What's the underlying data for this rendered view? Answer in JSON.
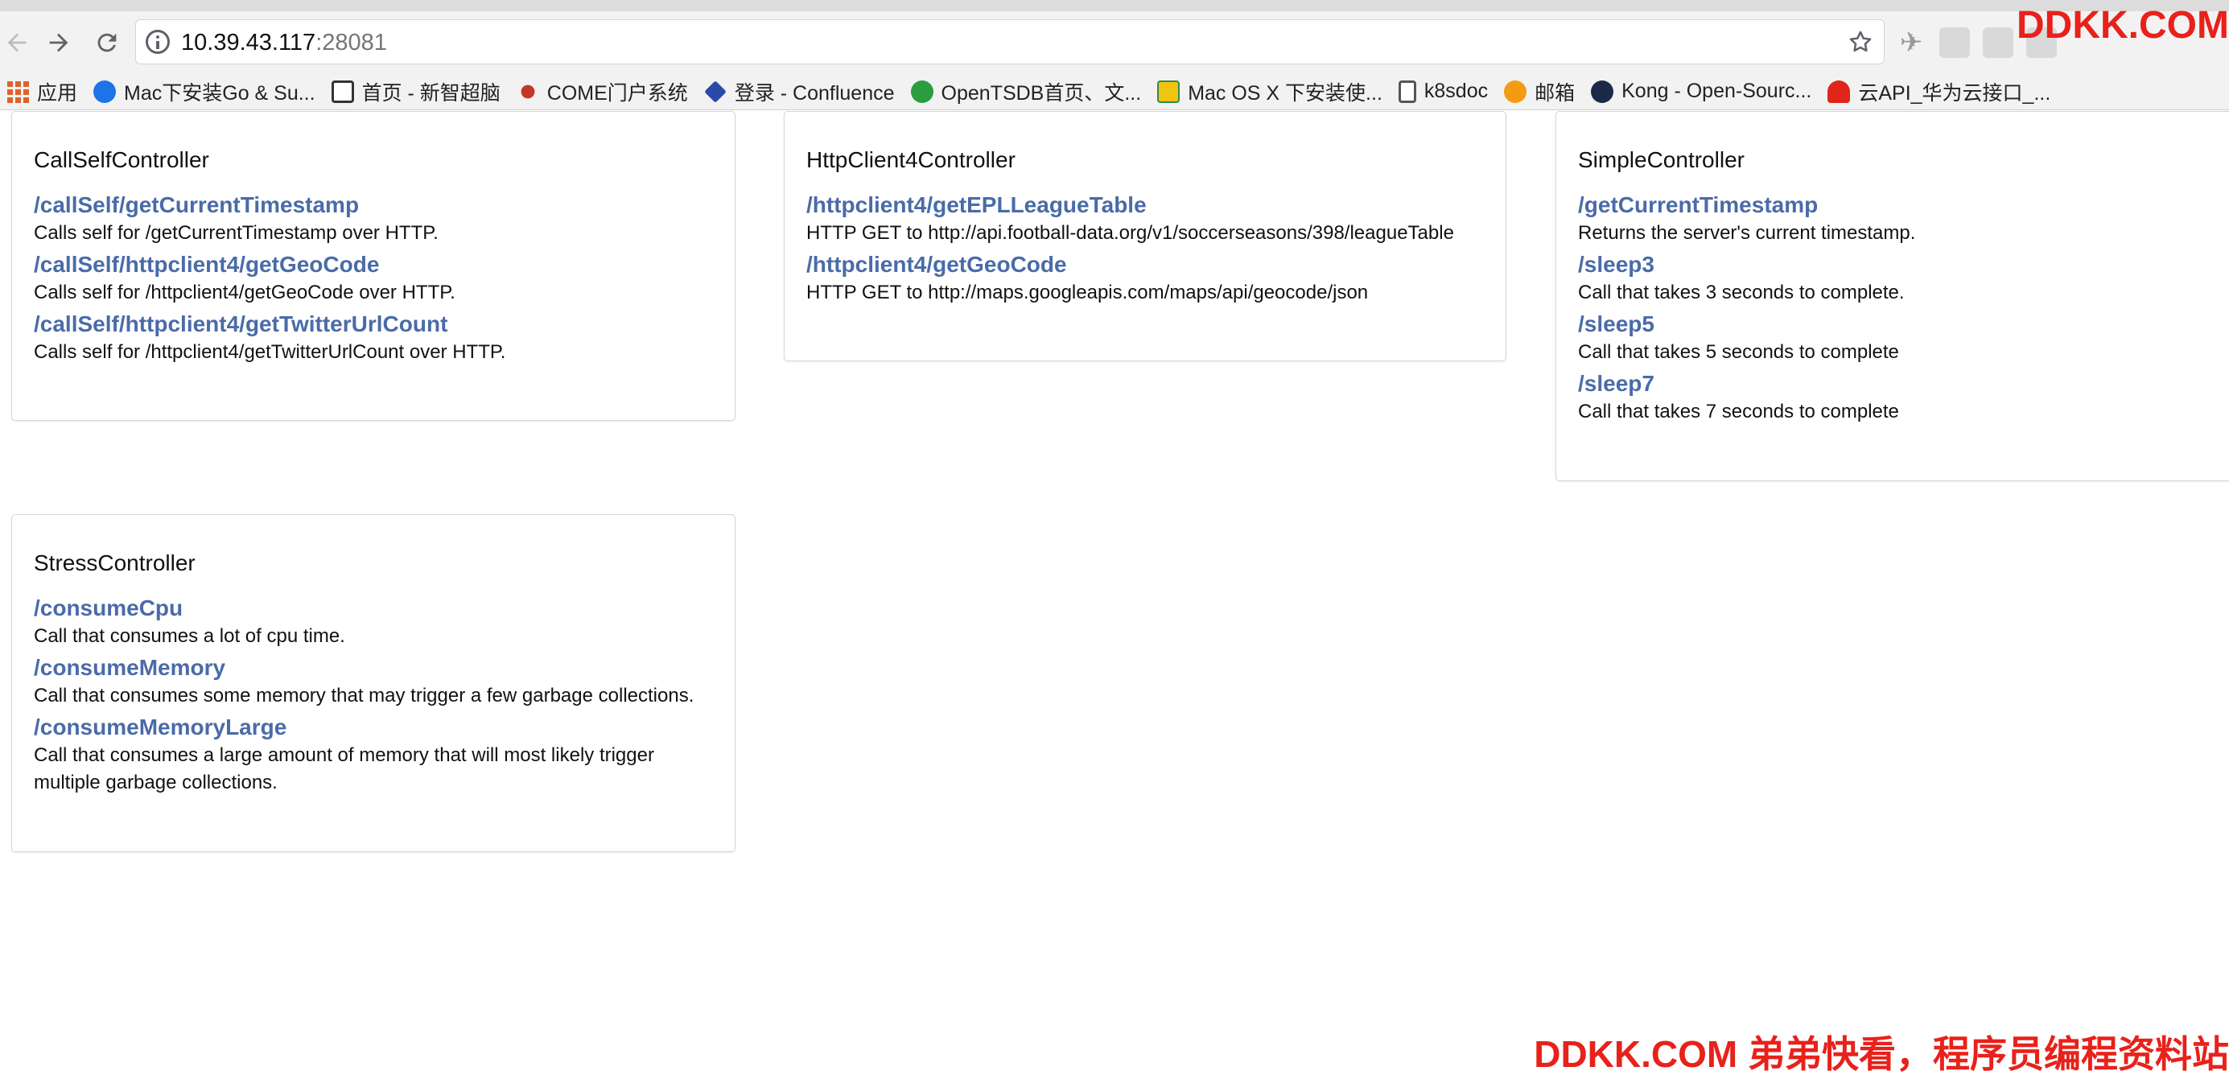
{
  "browser": {
    "url_host": "10.39.43.117",
    "url_port": ":28081",
    "bookmarks": [
      {
        "label": "应用",
        "icon": "apps-grid-icon"
      },
      {
        "label": "Mac下安装Go & Su...",
        "icon": "chrome-icon"
      },
      {
        "label": "首页 - 新智超脑",
        "icon": "edit-icon"
      },
      {
        "label": "COME门户系统",
        "icon": "come-icon"
      },
      {
        "label": "登录 - Confluence",
        "icon": "confluence-icon"
      },
      {
        "label": "OpenTSDB首页、文...",
        "icon": "opentsdb-icon"
      },
      {
        "label": "Mac OS X 下安装使...",
        "icon": "note-icon"
      },
      {
        "label": "k8sdoc",
        "icon": "file-icon"
      },
      {
        "label": "邮箱",
        "icon": "mail-icon"
      },
      {
        "label": "Kong - Open-Sourc...",
        "icon": "kong-icon"
      },
      {
        "label": "云API_华为云接口_...",
        "icon": "huawei-icon"
      }
    ]
  },
  "controllers": [
    {
      "title": "CallSelfController",
      "endpoints": [
        {
          "path": "/callSelf/getCurrentTimestamp",
          "description": "Calls self for /getCurrentTimestamp over HTTP."
        },
        {
          "path": "/callSelf/httpclient4/getGeoCode",
          "description": "Calls self for /httpclient4/getGeoCode over HTTP."
        },
        {
          "path": "/callSelf/httpclient4/getTwitterUrlCount",
          "description": "Calls self for /httpclient4/getTwitterUrlCount over HTTP."
        }
      ]
    },
    {
      "title": "HttpClient4Controller",
      "endpoints": [
        {
          "path": "/httpclient4/getEPLLeagueTable",
          "description": "HTTP GET to http://api.football-data.org/v1/soccerseasons/398/leagueTable"
        },
        {
          "path": "/httpclient4/getGeoCode",
          "description": "HTTP GET to http://maps.googleapis.com/maps/api/geocode/json"
        }
      ]
    },
    {
      "title": "SimpleController",
      "endpoints": [
        {
          "path": "/getCurrentTimestamp",
          "description": "Returns the server's current timestamp."
        },
        {
          "path": "/sleep3",
          "description": "Call that takes 3 seconds to complete."
        },
        {
          "path": "/sleep5",
          "description": "Call that takes 5 seconds to complete"
        },
        {
          "path": "/sleep7",
          "description": "Call that takes 7 seconds to complete"
        }
      ]
    },
    {
      "title": "StressController",
      "endpoints": [
        {
          "path": "/consumeCpu",
          "description": "Call that consumes a lot of cpu time."
        },
        {
          "path": "/consumeMemory",
          "description": "Call that consumes some memory that may trigger a few garbage collections."
        },
        {
          "path": "/consumeMemoryLarge",
          "description": "Call that consumes a large amount of memory that will most likely trigger multiple garbage collections."
        }
      ]
    }
  ],
  "watermark": {
    "top": "DDKK.COM",
    "bottom": "DDKK.COM 弟弟快看，程序员编程资料站"
  },
  "colors": {
    "link": "#4a6ba8",
    "watermark": "#e8211b",
    "chrome_bg": "#f2f2f2"
  }
}
